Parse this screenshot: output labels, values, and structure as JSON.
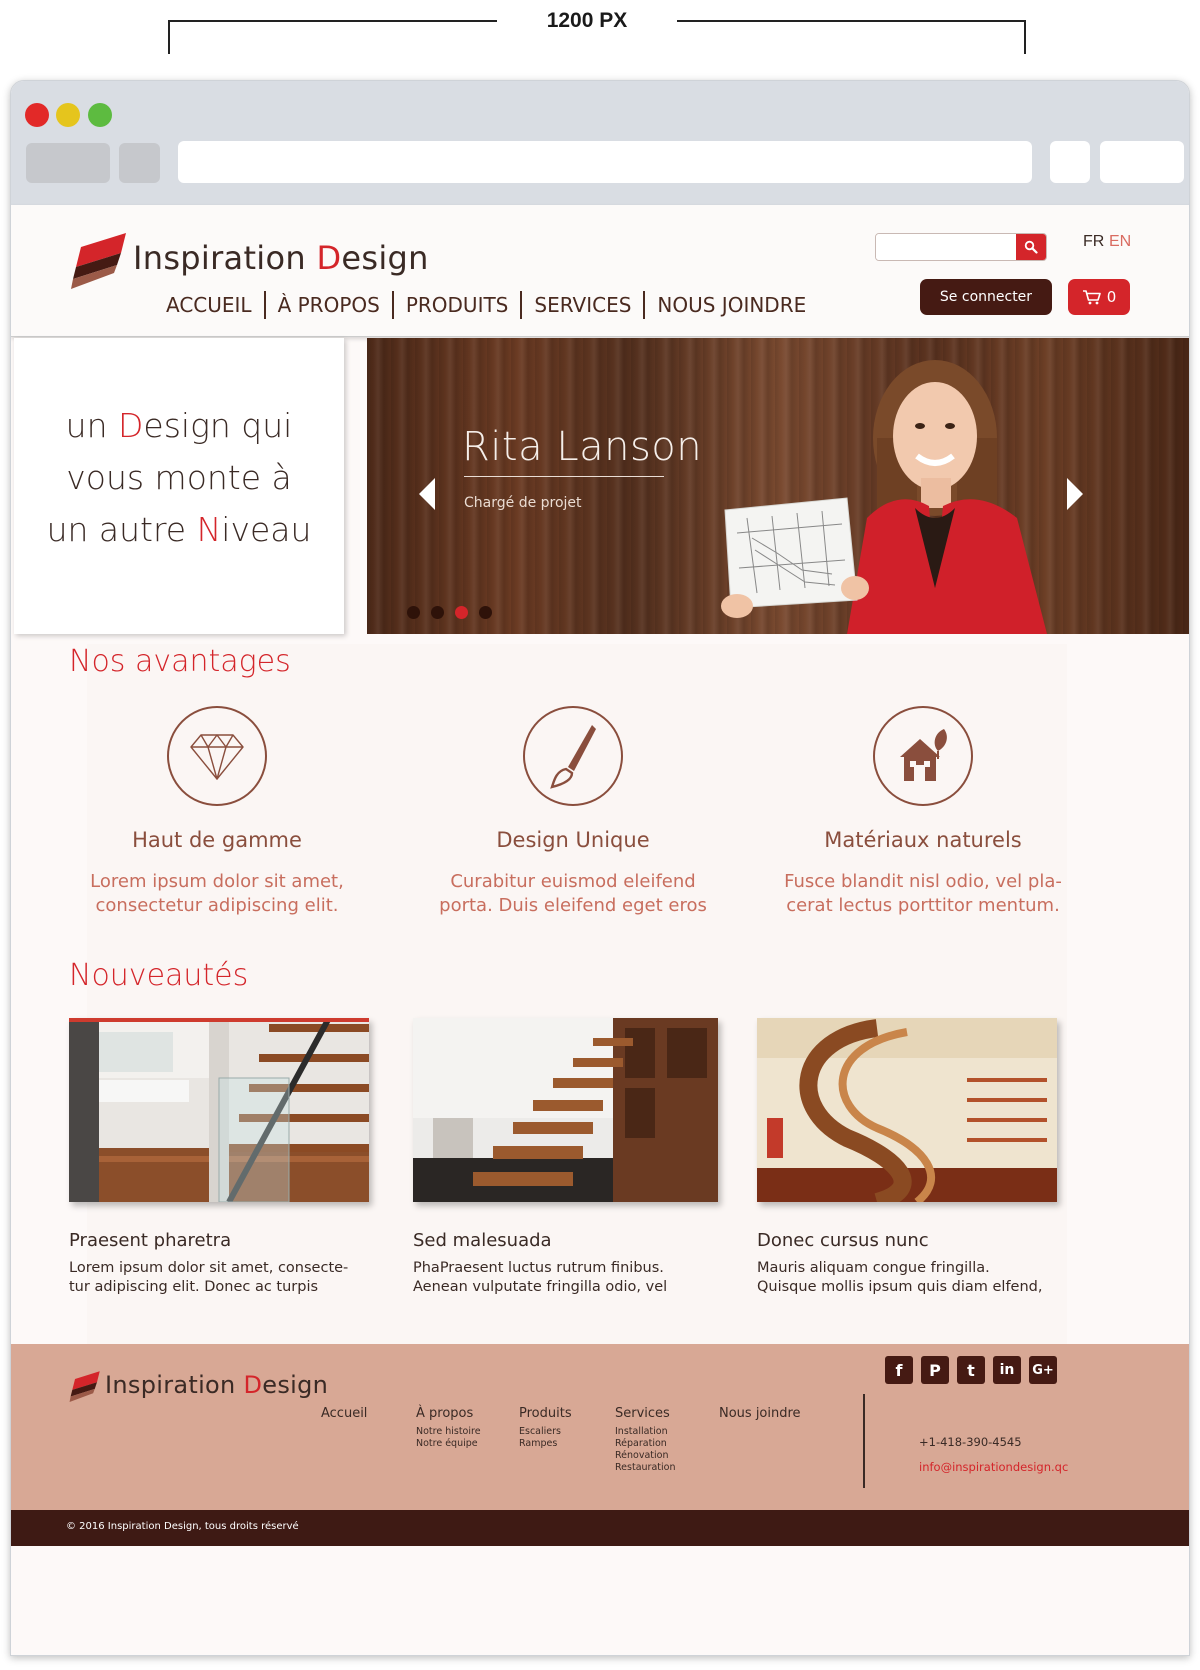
{
  "dimension_label": "1200 PX",
  "brand": {
    "name_part1": "Inspiration ",
    "name_accent": "D",
    "name_part2": "esign",
    "accent_color": "#d4252a",
    "dark_color": "#451a13"
  },
  "header": {
    "search_placeholder": "",
    "lang_fr": "FR",
    "lang_en": "EN",
    "login_label": "Se connecter",
    "cart_count": "0",
    "nav": [
      "ACCUEIL",
      "À PROPOS",
      "PRODUITS",
      "SERVICES",
      "NOUS JOINDRE"
    ]
  },
  "hero": {
    "tagline_l1_a": "un ",
    "tagline_l1_accent": "D",
    "tagline_l1_b": "esign qui",
    "tagline_l2": "vous monte à",
    "tagline_l3_a": "un autre ",
    "tagline_l3_accent": "N",
    "tagline_l3_b": "iveau",
    "slide_name": "Rita Lanson",
    "slide_role": "Chargé de projet",
    "slide_count": 4,
    "active_slide": 3
  },
  "advantages": {
    "title": "Nos avantages",
    "items": [
      {
        "icon": "diamond-icon",
        "title": "Haut de gamme",
        "text_l1": "Lorem ipsum dolor sit amet,",
        "text_l2": "consectetur adipiscing elit."
      },
      {
        "icon": "paintbrush-icon",
        "title": "Design Unique",
        "text_l1": "Curabitur euismod eleifend",
        "text_l2": "porta. Duis eleifend eget eros"
      },
      {
        "icon": "eco-house-icon",
        "title": "Matériaux naturels",
        "text_l1": "Fusce blandit nisl odio, vel pla-",
        "text_l2": "cerat lectus porttitor mentum."
      }
    ]
  },
  "news": {
    "title": "Nouveautés",
    "items": [
      {
        "title": "Praesent pharetra",
        "text_l1": "Lorem ipsum dolor sit amet, consecte-",
        "text_l2": "tur adipiscing elit. Donec ac turpis"
      },
      {
        "title": "Sed malesuada",
        "text_l1": "PhaPraesent luctus rutrum finibus.",
        "text_l2": "Aenean vulputate fringilla odio, vel"
      },
      {
        "title": "Donec cursus nunc",
        "text_l1": "Mauris aliquam congue fringilla.",
        "text_l2": "Quisque mollis ipsum quis diam elfend,"
      }
    ]
  },
  "footer": {
    "cols": [
      {
        "heading": "Accueil",
        "sub": []
      },
      {
        "heading": "À propos",
        "sub": [
          "Notre histoire",
          "Notre équipe"
        ]
      },
      {
        "heading": "Produits",
        "sub": [
          "Escaliers",
          "Rampes"
        ]
      },
      {
        "heading": "Services",
        "sub": [
          "Installation",
          "Réparation",
          "Rénovation",
          "Restauration"
        ]
      },
      {
        "heading": "Nous joindre",
        "sub": []
      }
    ],
    "social": [
      "f",
      "P",
      "t",
      "in",
      "G+"
    ],
    "phone": "+1-418-390-4545",
    "email": "info@inspirationdesign.qc",
    "copyright": "© 2016 Inspiration Design, tous droits réservé"
  }
}
